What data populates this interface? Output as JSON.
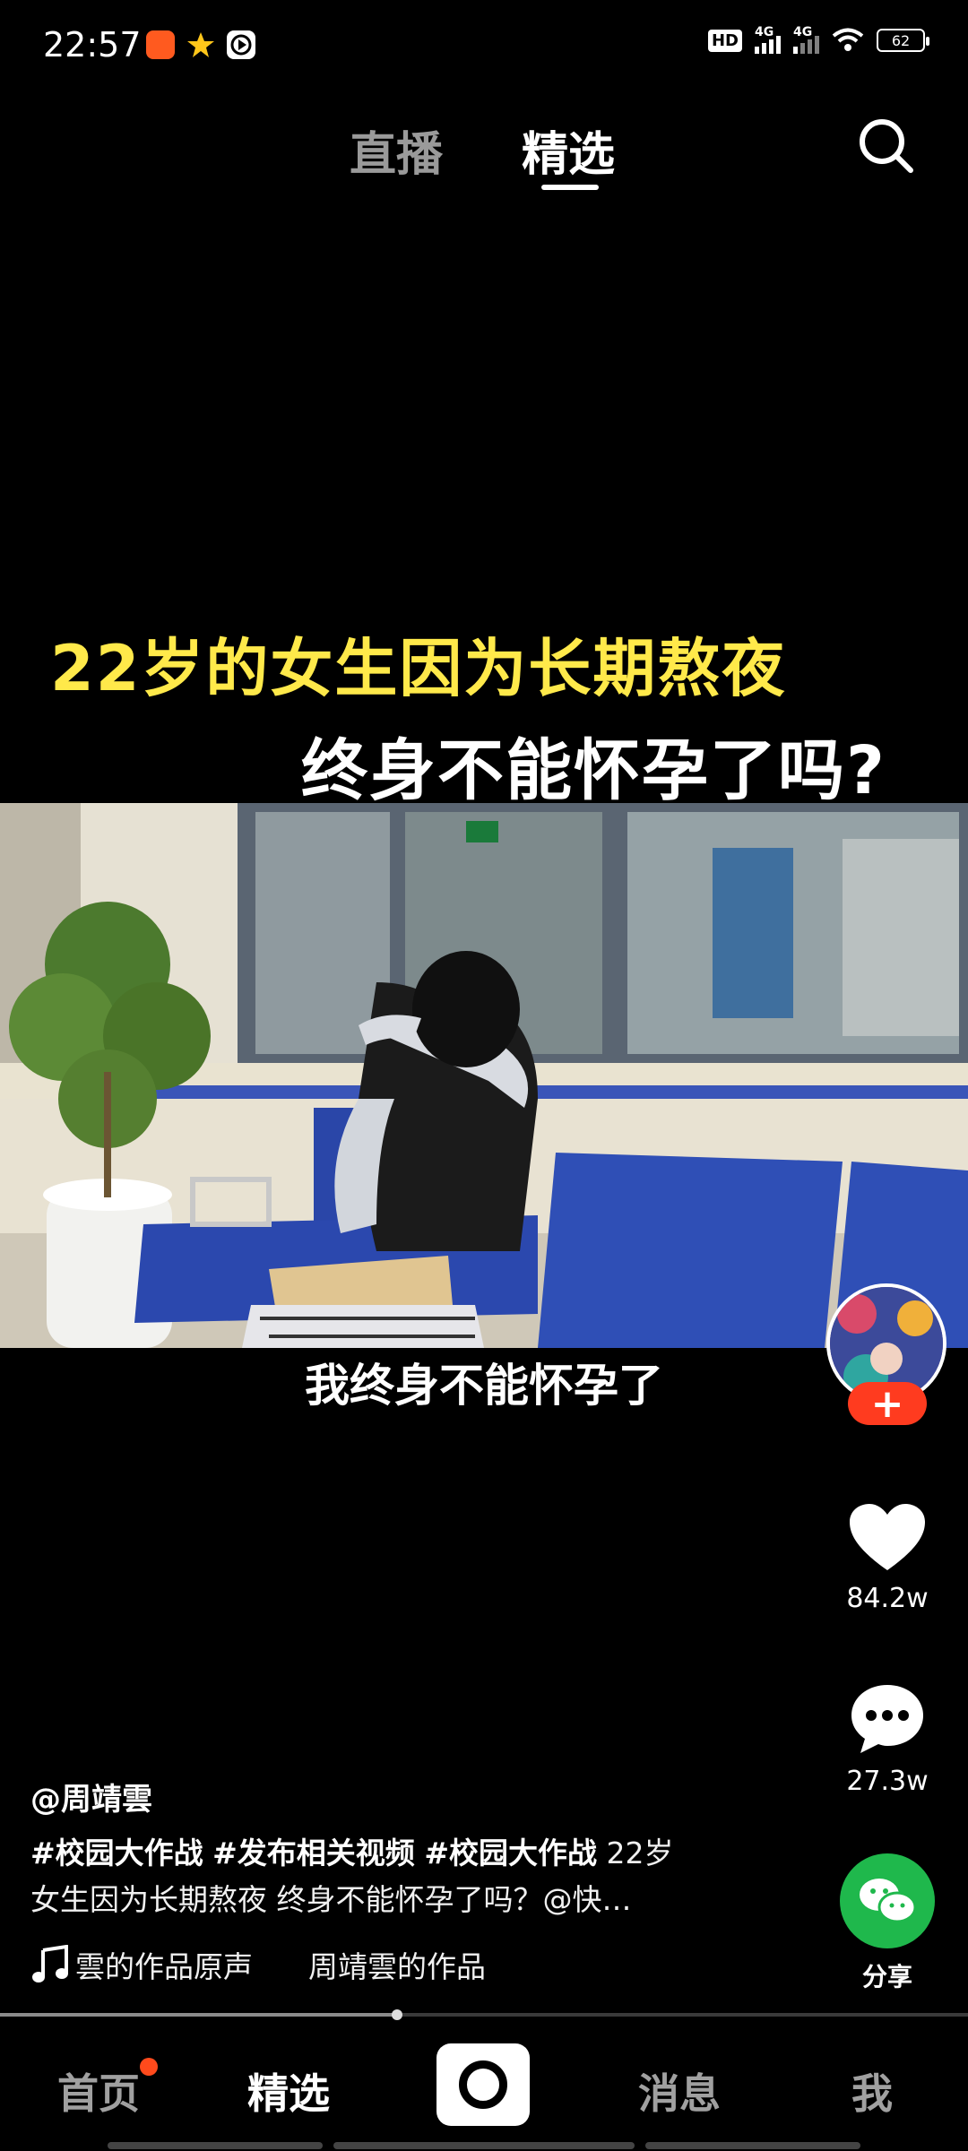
{
  "status_bar": {
    "time": "22:57",
    "network_1": "4G",
    "network_2": "4G",
    "hd_label": "HD",
    "battery": "62"
  },
  "top_tabs": {
    "live": "直播",
    "featured": "精选"
  },
  "video": {
    "headline_line1": "22岁的女生因为长期熬夜",
    "headline_line2": "终身不能怀孕了吗?",
    "subtitle": "我终身不能怀孕了"
  },
  "right_rail": {
    "likes": "84.2w",
    "comments": "27.3w",
    "share": "分享"
  },
  "caption": {
    "author": "@周靖雲",
    "tag1": "#校园大作战",
    "tag2": "#发布相关视频",
    "tag3": "#校园大作战",
    "text_line1_tail": "22岁",
    "text_line2": "女生因为长期熬夜 终身不能怀孕了吗？@快…",
    "music_title": "雲的作品原声",
    "music_work": "周靖雲的作品"
  },
  "progress": {
    "fraction": 0.41
  },
  "bottom_nav": {
    "home": "首页",
    "featured": "精选",
    "messages": "消息",
    "me": "我"
  },
  "colors": {
    "headline_yellow": "#ffe94a",
    "follow_red": "#ff3b1f",
    "share_green": "#1fb84c",
    "notification_dot": "#ff4a1c"
  }
}
